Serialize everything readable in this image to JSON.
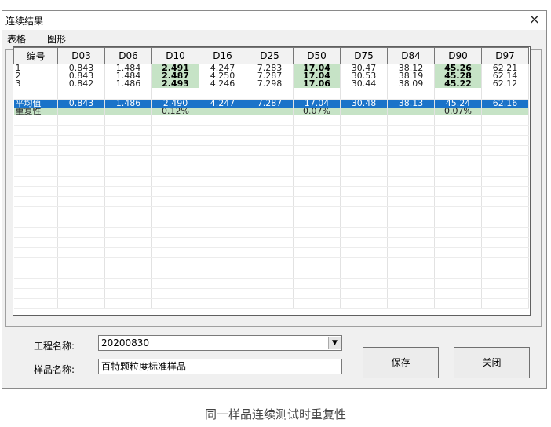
{
  "window": {
    "title": "连续结果",
    "close_glyph": "×"
  },
  "tabs": [
    {
      "label": "表格"
    },
    {
      "label": "图形"
    }
  ],
  "table": {
    "headers": [
      "编号",
      "D03",
      "D06",
      "D10",
      "D16",
      "D25",
      "D50",
      "D75",
      "D84",
      "D90",
      "D97"
    ],
    "rows": [
      [
        "1",
        "0.843",
        "1.484",
        "2.491",
        "4.247",
        "7.283",
        "17.04",
        "30.47",
        "38.12",
        "45.26",
        "62.21"
      ],
      [
        "2",
        "0.843",
        "1.484",
        "2.487",
        "4.250",
        "7.287",
        "17.04",
        "30.53",
        "38.19",
        "45.28",
        "62.14"
      ],
      [
        "3",
        "0.842",
        "1.486",
        "2.493",
        "4.246",
        "7.298",
        "17.06",
        "30.44",
        "38.09",
        "45.22",
        "62.12"
      ]
    ],
    "average": [
      "平均值",
      "0.843",
      "1.486",
      "2.490",
      "4.247",
      "7.287",
      "17.04",
      "30.48",
      "38.13",
      "45.24",
      "62.16"
    ],
    "repeatability": [
      "重复性",
      "",
      "",
      "0.12%",
      "",
      "",
      "0.07%",
      "",
      "",
      "0.07%",
      ""
    ]
  },
  "form": {
    "project_label": "工程名称:",
    "project_value": "20200830",
    "sample_label": "样品名称:",
    "sample_value": "百特颗粒度标准样品",
    "combo_arrow": "▼"
  },
  "buttons": {
    "save": "保存",
    "close": "关闭"
  },
  "caption": "同一样品连续测试时重复性",
  "colors": {
    "highlight_green": "#c6e3c6",
    "selected_blue": "#1a73c9"
  }
}
